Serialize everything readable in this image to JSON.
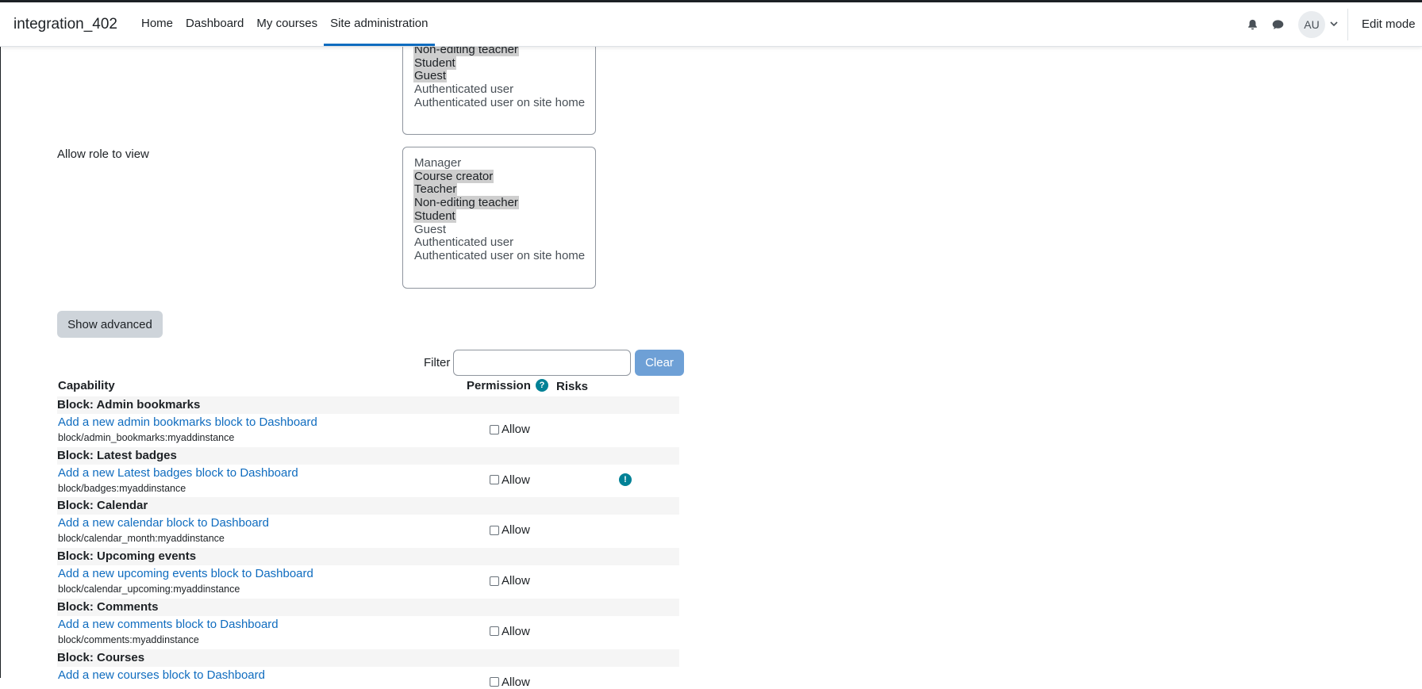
{
  "navbar": {
    "brand": "integration_402",
    "links": [
      {
        "label": "Home"
      },
      {
        "label": "Dashboard"
      },
      {
        "label": "My courses"
      },
      {
        "label": "Site administration",
        "active": true
      }
    ],
    "avatar_initials": "AU",
    "edit_mode_label": "Edit mode"
  },
  "listbox_top": {
    "options": [
      {
        "label": "Non-editing teacher",
        "selected": true
      },
      {
        "label": "Student",
        "selected": true
      },
      {
        "label": "Guest",
        "selected": true
      },
      {
        "label": "Authenticated user",
        "selected": false
      },
      {
        "label": "Authenticated user on site home",
        "selected": false
      }
    ]
  },
  "allow_view": {
    "label": "Allow role to view",
    "options": [
      {
        "label": "Manager",
        "selected": false
      },
      {
        "label": "Course creator",
        "selected": true
      },
      {
        "label": "Teacher",
        "selected": true
      },
      {
        "label": "Non-editing teacher",
        "selected": true
      },
      {
        "label": "Student",
        "selected": true
      },
      {
        "label": "Guest",
        "selected": false
      },
      {
        "label": "Authenticated user",
        "selected": false
      },
      {
        "label": "Authenticated user on site home",
        "selected": false
      }
    ]
  },
  "show_advanced_label": "Show advanced",
  "filter": {
    "label": "Filter",
    "value": "",
    "clear_label": "Clear"
  },
  "table": {
    "headers": {
      "capability": "Capability",
      "permission": "Permission",
      "risks": "Risks"
    },
    "help_glyph": "?",
    "risk_glyph": "!",
    "groups": [
      {
        "title": "Block: Admin bookmarks",
        "link": "Add a new admin bookmarks block to Dashboard",
        "code": "block/admin_bookmarks:myaddinstance",
        "permission": "Allow",
        "risk": false
      },
      {
        "title": "Block: Latest badges",
        "link": "Add a new Latest badges block to Dashboard",
        "code": "block/badges:myaddinstance",
        "permission": "Allow",
        "risk": true
      },
      {
        "title": "Block: Calendar",
        "link": "Add a new calendar block to Dashboard",
        "code": "block/calendar_month:myaddinstance",
        "permission": "Allow",
        "risk": false
      },
      {
        "title": "Block: Upcoming events",
        "link": "Add a new upcoming events block to Dashboard",
        "code": "block/calendar_upcoming:myaddinstance",
        "permission": "Allow",
        "risk": false
      },
      {
        "title": "Block: Comments",
        "link": "Add a new comments block to Dashboard",
        "code": "block/comments:myaddinstance",
        "permission": "Allow",
        "risk": false
      },
      {
        "title": "Block: Courses",
        "link": "Add a new courses block to Dashboard",
        "code": "",
        "permission": "Allow",
        "risk": false
      }
    ]
  }
}
